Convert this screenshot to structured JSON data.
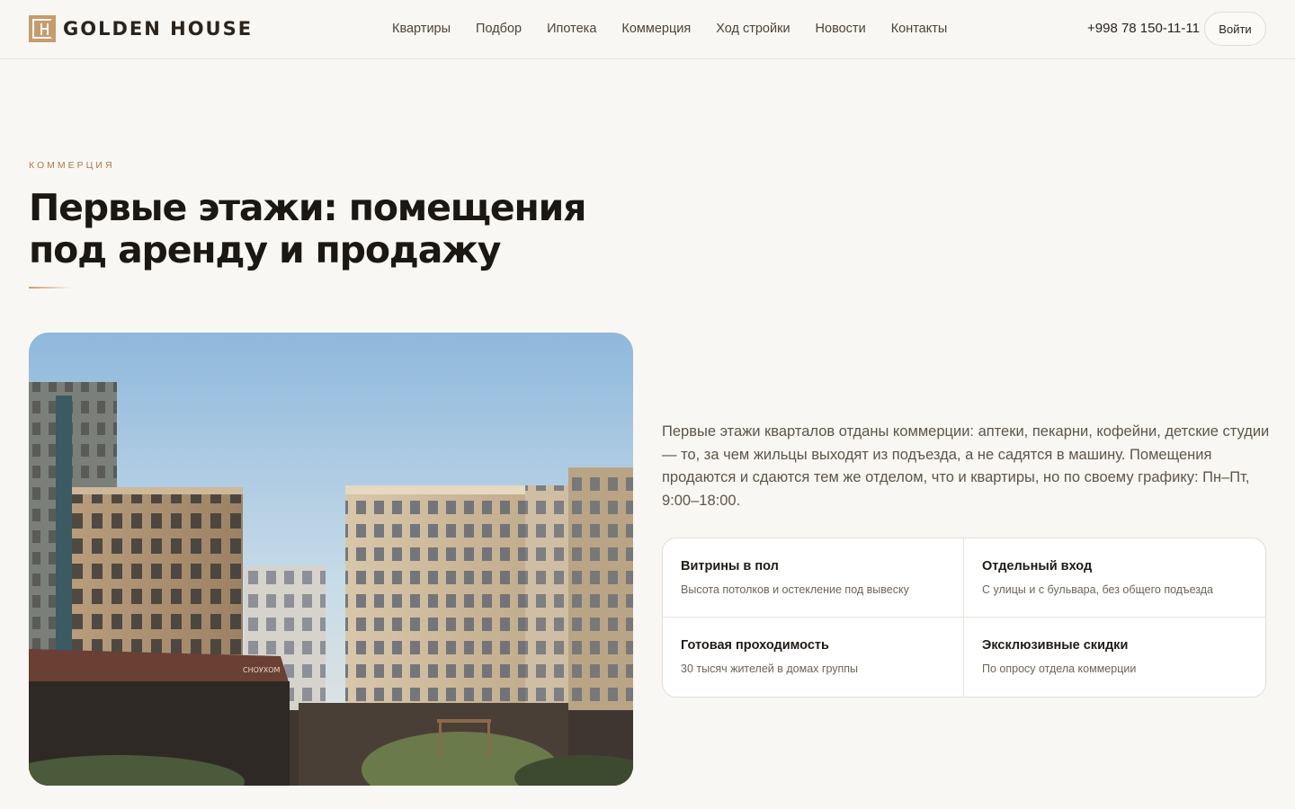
{
  "header": {
    "logo_text": "GOLDEN HOUSE",
    "nav": [
      {
        "label": "Квартиры"
      },
      {
        "label": "Подбор"
      },
      {
        "label": "Ипотека"
      },
      {
        "label": "Коммерция"
      },
      {
        "label": "Ход стройки"
      },
      {
        "label": "Новости"
      },
      {
        "label": "Контакты"
      }
    ],
    "phone": "+998 78 150-11-11",
    "login_label": "Войти"
  },
  "section": {
    "eyebrow": "КОММЕРЦИЯ",
    "title": "Первые этажи: помещения под аренду и продажу",
    "description": "Первые этажи кварталов отданы коммерции: аптеки, пекарни, кофейни, детские студии — то, за чем жильцы выходят из подъезда, а не садятся в машину. Помещения продаются и сдаются тем же отделом, что и квартиры, но по своему графику: Пн–Пт, 9:00–18:00.",
    "photo_sign": "СНОУХОМ",
    "features": [
      {
        "title": "Витрины в пол",
        "subtitle": "Высота потолков и остекление под вывеску"
      },
      {
        "title": "Отдельный вход",
        "subtitle": "С улицы и с бульвара, без общего подъезда"
      },
      {
        "title": "Готовая проходимость",
        "subtitle": "30 тысяч жителей в домах группы"
      },
      {
        "title": "Эксклюзивные скидки",
        "subtitle": "По опросу отдела коммерции"
      }
    ]
  },
  "colors": {
    "accent": "#c69c6d",
    "background": "#f9f7f3"
  }
}
